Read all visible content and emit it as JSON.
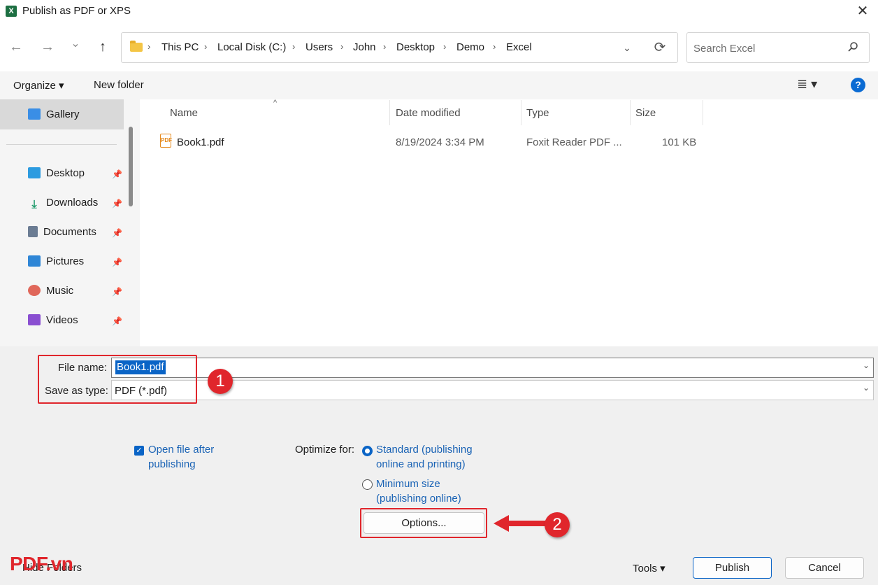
{
  "window": {
    "title": "Publish as PDF or XPS",
    "app_icon": "excel-icon",
    "close_glyph": "✕"
  },
  "nav": {
    "back_glyph": "←",
    "forward_glyph": "→",
    "recent_glyph": "⌄",
    "up_glyph": "↑",
    "breadcrumb": [
      "This PC",
      "Local Disk (C:)",
      "Users",
      "John",
      "Desktop",
      "Demo",
      "Excel"
    ],
    "sep_glyph": "›",
    "dropdown_glyph": "⌄",
    "refresh_glyph": "⟳"
  },
  "search": {
    "placeholder": "Search Excel",
    "value": ""
  },
  "toolbar": {
    "organize_label": "Organize ▾",
    "new_folder_label": "New folder",
    "view_glyph": "≣  ▾",
    "help_glyph": "?"
  },
  "sidebar": {
    "gallery_label": "Gallery",
    "items": [
      {
        "label": "Desktop",
        "icon": "desktop-icon"
      },
      {
        "label": "Downloads",
        "icon": "downloads-icon"
      },
      {
        "label": "Documents",
        "icon": "documents-icon"
      },
      {
        "label": "Pictures",
        "icon": "pictures-icon"
      },
      {
        "label": "Music",
        "icon": "music-icon"
      },
      {
        "label": "Videos",
        "icon": "videos-icon"
      }
    ],
    "pin_glyph": "📌"
  },
  "files": {
    "columns": [
      "Name",
      "Date modified",
      "Type",
      "Size"
    ],
    "sort_glyph": "^",
    "rows": [
      {
        "name": "Book1.pdf",
        "date": "8/19/2024 3:34 PM",
        "type": "Foxit Reader PDF ...",
        "size": "101 KB"
      }
    ]
  },
  "form": {
    "file_name_label": "File name:",
    "file_name_value": "Book1.pdf",
    "save_type_label": "Save as type:",
    "save_type_value": "PDF (*.pdf)",
    "open_after_line1": "Open file after",
    "open_after_line2": "publishing",
    "open_after_checked": true,
    "optimize_label": "Optimize for:",
    "standard_line1": "Standard (publishing",
    "standard_line2": "online and printing)",
    "minimum_line1": "Minimum size",
    "minimum_line2": "(publishing online)",
    "selected_option": "standard",
    "options_button": "Options..."
  },
  "footer": {
    "hide_folders": "Hide Folders",
    "tools_label": "Tools  ▾",
    "publish_label": "Publish",
    "cancel_label": "Cancel"
  },
  "annotations": {
    "badge1": "1",
    "badge2": "2",
    "watermark": "PDF.vn",
    "highlight_color": "#e0262c"
  }
}
